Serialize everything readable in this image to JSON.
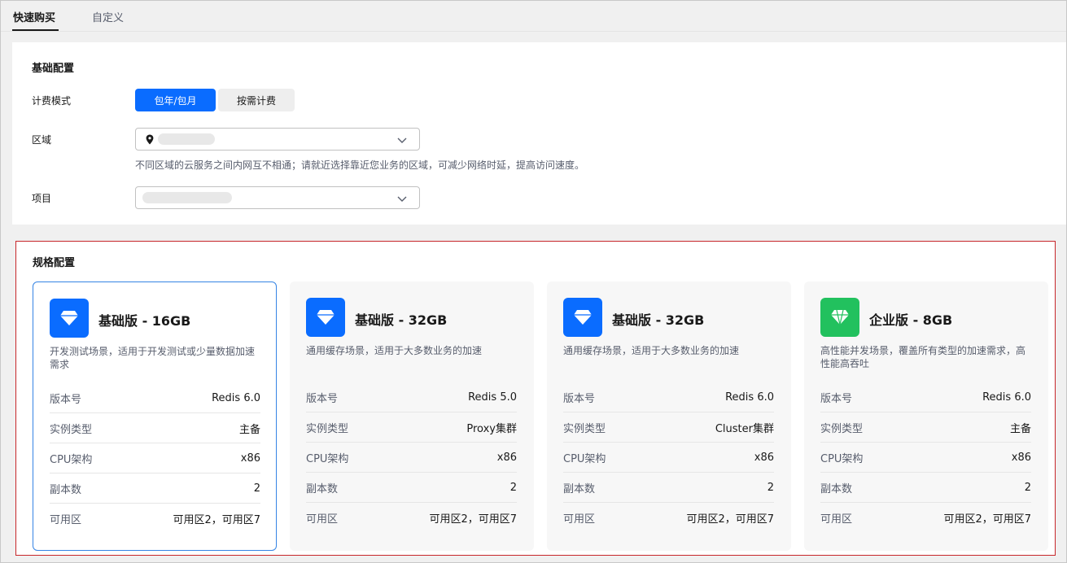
{
  "tabs": [
    {
      "label": "快速购买",
      "active": true
    },
    {
      "label": "自定义",
      "active": false
    }
  ],
  "basic": {
    "title": "基础配置",
    "billing": {
      "label": "计费模式",
      "options": [
        "包年/包月",
        "按需计费"
      ],
      "selected": "包年/包月"
    },
    "region": {
      "label": "区域",
      "hint": "不同区域的云服务之间内网互不相通；请就近选择靠近您业务的区域，可减少网络时延，提高访问速度。"
    },
    "project": {
      "label": "项目"
    }
  },
  "spec": {
    "title": "规格配置",
    "row_labels": [
      "版本号",
      "实例类型",
      "CPU架构",
      "副本数",
      "可用区"
    ],
    "cards": [
      {
        "title": "基础版 - 16GB",
        "desc": "开发测试场景，适用于开发测试或少量数据加速需求",
        "icon": "diamond-icon",
        "icon_color": "#0a6cff",
        "selected": true,
        "values": [
          "Redis 6.0",
          "主备",
          "x86",
          "2",
          "可用区2，可用区7"
        ]
      },
      {
        "title": "基础版 - 32GB",
        "desc": "通用缓存场景，适用于大多数业务的加速",
        "icon": "diamond-icon",
        "icon_color": "#0a6cff",
        "selected": false,
        "values": [
          "Redis 5.0",
          "Proxy集群",
          "x86",
          "2",
          "可用区2，可用区7"
        ]
      },
      {
        "title": "基础版 - 32GB",
        "desc": "通用缓存场景，适用于大多数业务的加速",
        "icon": "diamond-icon",
        "icon_color": "#0a6cff",
        "selected": false,
        "values": [
          "Redis 6.0",
          "Cluster集群",
          "x86",
          "2",
          "可用区2，可用区7"
        ]
      },
      {
        "title": "企业版 - 8GB",
        "desc": "高性能并发场景，覆盖所有类型的加速需求，高性能高吞吐",
        "icon": "diamond-icon",
        "icon_color": "#22c15e",
        "selected": false,
        "values": [
          "Redis 6.0",
          "主备",
          "x86",
          "2",
          "可用区2，可用区7"
        ]
      }
    ]
  },
  "colors": {
    "primary": "#0a6cff",
    "enterprise": "#22c15e",
    "highlight_border": "#c7262a"
  }
}
